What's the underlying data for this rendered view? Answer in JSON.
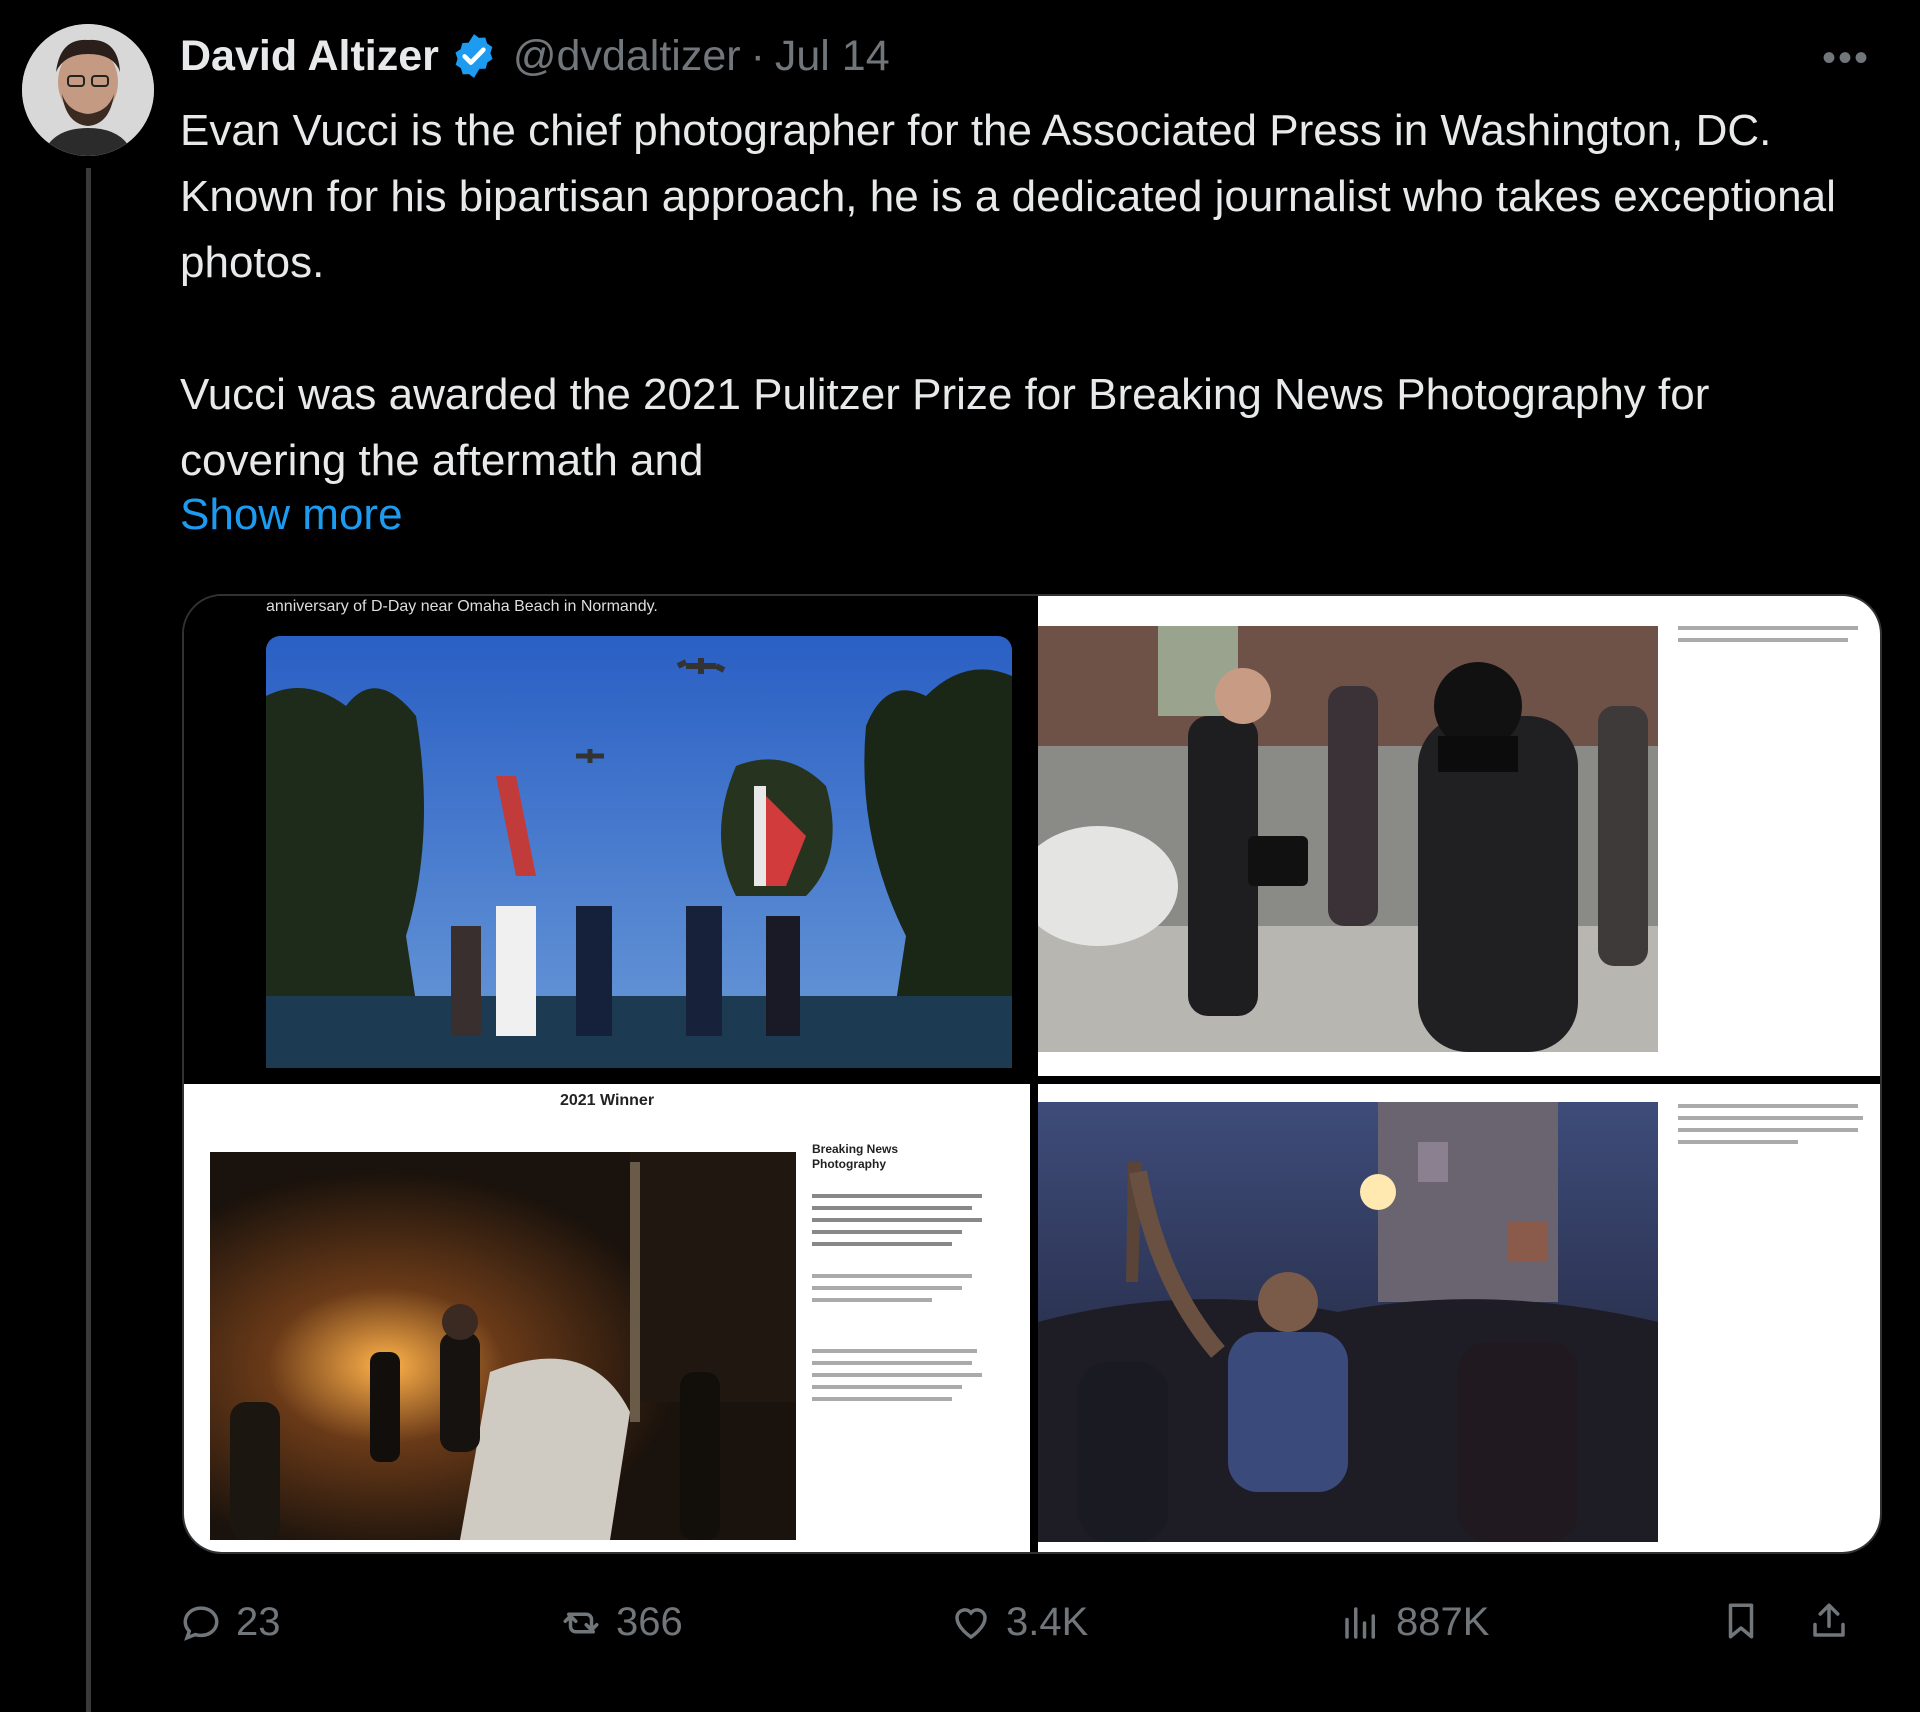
{
  "author": {
    "name": "David Altizer",
    "handle": "@dvdaltizer",
    "date_sep": "·",
    "date": "Jul 14"
  },
  "tweet": {
    "paragraph1": "Evan Vucci is the chief photographer for the Associated Press in Washington, DC. Known for his bipartisan approach, he is a dedicated journalist who takes exceptional photos.",
    "paragraph2": "Vucci was awarded the 2021 Pulitzer Prize for Breaking News Photography for covering the aftermath and",
    "show_more": "Show more"
  },
  "media": {
    "caption_top": "anniversary of D-Day near Omaha Beach in Normandy.",
    "winner_label": "2021 Winner",
    "side_title": "Breaking News Photography"
  },
  "actions": {
    "replies": "23",
    "reposts": "366",
    "likes": "3.4K",
    "views": "887K"
  },
  "colors": {
    "background": "#000000",
    "text": "#e7e9ea",
    "muted": "#71767b",
    "link": "#1d9bf0",
    "verified": "#1d9bf0"
  },
  "icons": [
    "more-options-icon",
    "verified-badge-icon",
    "reply-icon",
    "repost-icon",
    "like-icon",
    "views-icon",
    "bookmark-icon",
    "share-icon"
  ]
}
